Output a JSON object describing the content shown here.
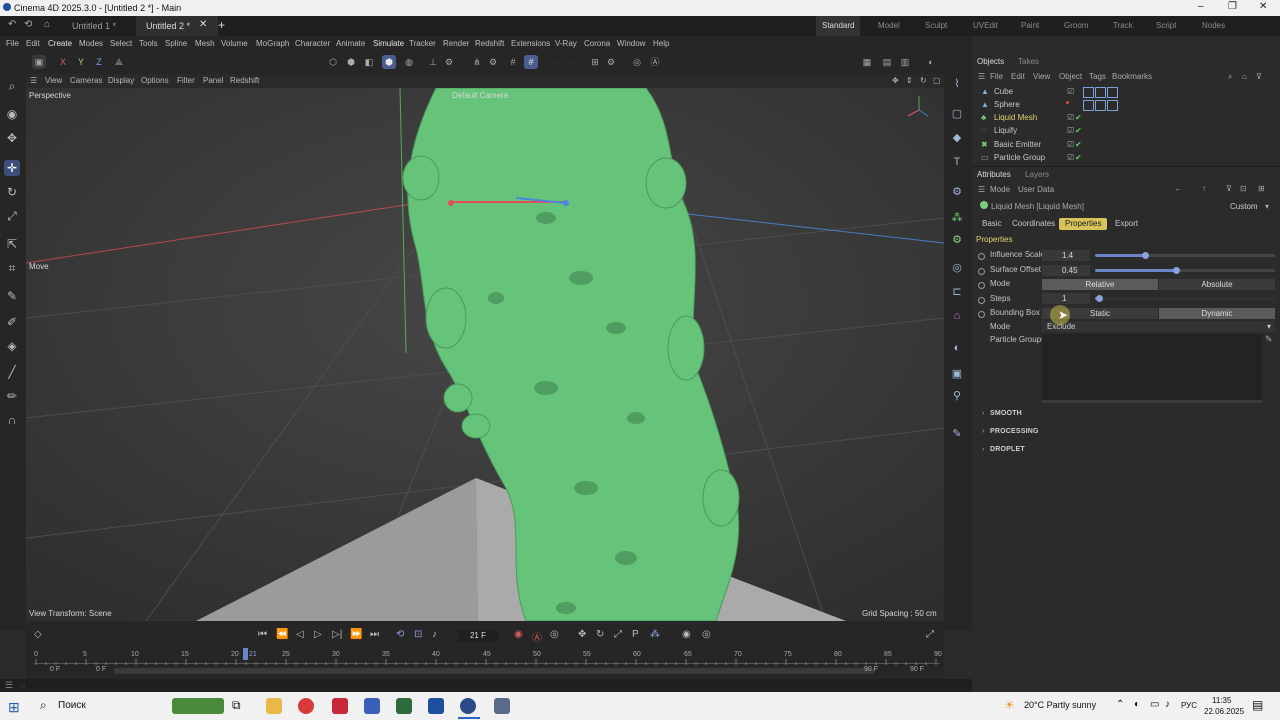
{
  "window": {
    "title": "Cinema 4D 2025.3.0 - [Untitled 2 *] - Main",
    "min": "–",
    "max": "❐",
    "close": "✕"
  },
  "doc_tabs": [
    "Untitled 1 *",
    "Untitled 2 *"
  ],
  "layouts": [
    "Standard",
    "Model",
    "Sculpt",
    "UVEdit",
    "Paint",
    "Groom",
    "Track",
    "Script",
    "Nodes"
  ],
  "menu": [
    "File",
    "Edit",
    "Create",
    "Modes",
    "Select",
    "Tools",
    "Spline",
    "Mesh",
    "Volume",
    "MoGraph",
    "Character",
    "Animate",
    "Simulate",
    "Tracker",
    "Render",
    "Redshift",
    "Extensions",
    "V-Ray",
    "Corona",
    "Window",
    "Help"
  ],
  "axis_toggles": [
    "X",
    "Y",
    "Z"
  ],
  "viewport": {
    "menu": [
      "View",
      "Cameras",
      "Display",
      "Options",
      "Filter",
      "Panel",
      "Redshift"
    ],
    "name": "Perspective",
    "camera": "Default Camera",
    "tool_label": "Move",
    "view_transform": "View Transform: Scene",
    "grid_spacing": "Grid Spacing : 50 cm"
  },
  "objects_panel": {
    "tabs": [
      "Objects",
      "Takes"
    ],
    "menu": [
      "File",
      "Edit",
      "View",
      "Object",
      "Tags",
      "Bookmarks"
    ],
    "items": [
      {
        "name": "Cube",
        "icon": "cube-icon",
        "selected": false
      },
      {
        "name": "Sphere",
        "icon": "sphere-icon",
        "selected": false
      },
      {
        "name": "Liquid Mesh",
        "icon": "liquid-mesh-icon",
        "selected": true
      },
      {
        "name": "Liquify",
        "icon": "liquify-icon",
        "selected": false
      },
      {
        "name": "Basic Emitter",
        "icon": "emitter-icon",
        "selected": false
      },
      {
        "name": "Particle Group",
        "icon": "folder-icon",
        "selected": false
      }
    ]
  },
  "attributes": {
    "tabs": [
      "Attributes",
      "Layers"
    ],
    "menu": [
      "Mode",
      "User Data"
    ],
    "object_title": "Liquid Mesh [Liquid Mesh]",
    "preset": "Custom",
    "subtabs": [
      "Basic",
      "Coordinates",
      "Properties",
      "Export"
    ],
    "active_subtab": "Properties",
    "section_title": "Properties",
    "influence_scale": {
      "label": "Influence Scale",
      "value": "1.4",
      "fraction": 0.28
    },
    "surface_offset": {
      "label": "Surface Offset",
      "value": "0.45",
      "fraction": 0.45
    },
    "mode": {
      "label": "Mode",
      "options": [
        "Relative",
        "Absolute"
      ],
      "selected": "Relative"
    },
    "steps": {
      "label": "Steps",
      "value": "1",
      "fraction": 0.02
    },
    "bounding_box": {
      "label": "Bounding Box",
      "options": [
        "Static",
        "Dynamic"
      ],
      "selected": "Dynamic"
    },
    "mode2": {
      "label": "Mode",
      "value": "Exclude"
    },
    "particle_groups": {
      "label": "Particle Groups"
    },
    "collapsed_sections": [
      "SMOOTH",
      "PROCESSING",
      "DROPLET"
    ]
  },
  "timeline": {
    "current_frame": "21 F",
    "current_value": 21,
    "ticks": [
      "0",
      "5",
      "10",
      "15",
      "20",
      "25",
      "30",
      "35",
      "40",
      "45",
      "50",
      "55",
      "60",
      "65",
      "70",
      "75",
      "80",
      "85",
      "90"
    ],
    "marker": "21",
    "start_a": "0 F",
    "start_b": "0 F",
    "end_a": "90 F",
    "end_b": "90 F"
  },
  "taskbar": {
    "search": "Поиск",
    "weather": "20°C  Partly sunny",
    "lang": "РУС",
    "time": "11:35",
    "date": "22.06.2025"
  },
  "colors": {
    "accent": "#d7c35a",
    "liquid": "#63c277",
    "selection": "#4a5e8f"
  }
}
